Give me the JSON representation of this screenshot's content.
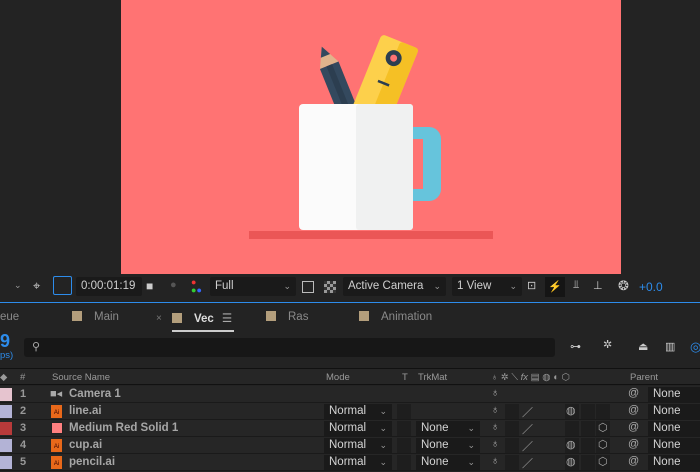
{
  "toolbar": {
    "timecode": "0:00:01:19",
    "resolution": "Full",
    "camera": "Active Camera",
    "views": "1 View",
    "exposure": "+0.0"
  },
  "tabs": [
    {
      "label": "eue"
    },
    {
      "label": "Main"
    },
    {
      "label": "Vec"
    },
    {
      "label": "Ras"
    },
    {
      "label": "Animation"
    }
  ],
  "timeline": {
    "frame_fragment": "9",
    "fps_fragment": "ps)",
    "search_placeholder": ""
  },
  "columns": {
    "source_name": "Source Name",
    "hash": "#",
    "mode": "Mode",
    "t": "T",
    "trkmat": "TrkMat",
    "fx": "fx",
    "parent": "Parent"
  },
  "layers": [
    {
      "num": "1",
      "name": "Camera 1",
      "label_color": "#e6c4cf",
      "icon": "camera-icon",
      "mode": "",
      "trkmat": "",
      "parent": "None"
    },
    {
      "num": "2",
      "name": "line.ai",
      "label_color": "#b3b3d6",
      "icon": "illustrator-file-icon",
      "mode": "Normal",
      "trkmat": "",
      "parent": "None"
    },
    {
      "num": "3",
      "name": "Medium Red Solid 1",
      "label_color": "#b83a3a",
      "icon": "solid-icon",
      "mode": "Normal",
      "trkmat": "None",
      "parent": "None"
    },
    {
      "num": "4",
      "name": "cup.ai",
      "label_color": "#b3b3d6",
      "icon": "illustrator-file-icon",
      "mode": "Normal",
      "trkmat": "None",
      "parent": "None"
    },
    {
      "num": "5",
      "name": "pencil.ai",
      "label_color": "#b3b3d6",
      "icon": "illustrator-file-icon",
      "mode": "Normal",
      "trkmat": "None",
      "parent": "None"
    }
  ],
  "colors": {
    "canvas": "#ff7373",
    "accent": "#2d8ceb",
    "solid": "#ff8080"
  }
}
